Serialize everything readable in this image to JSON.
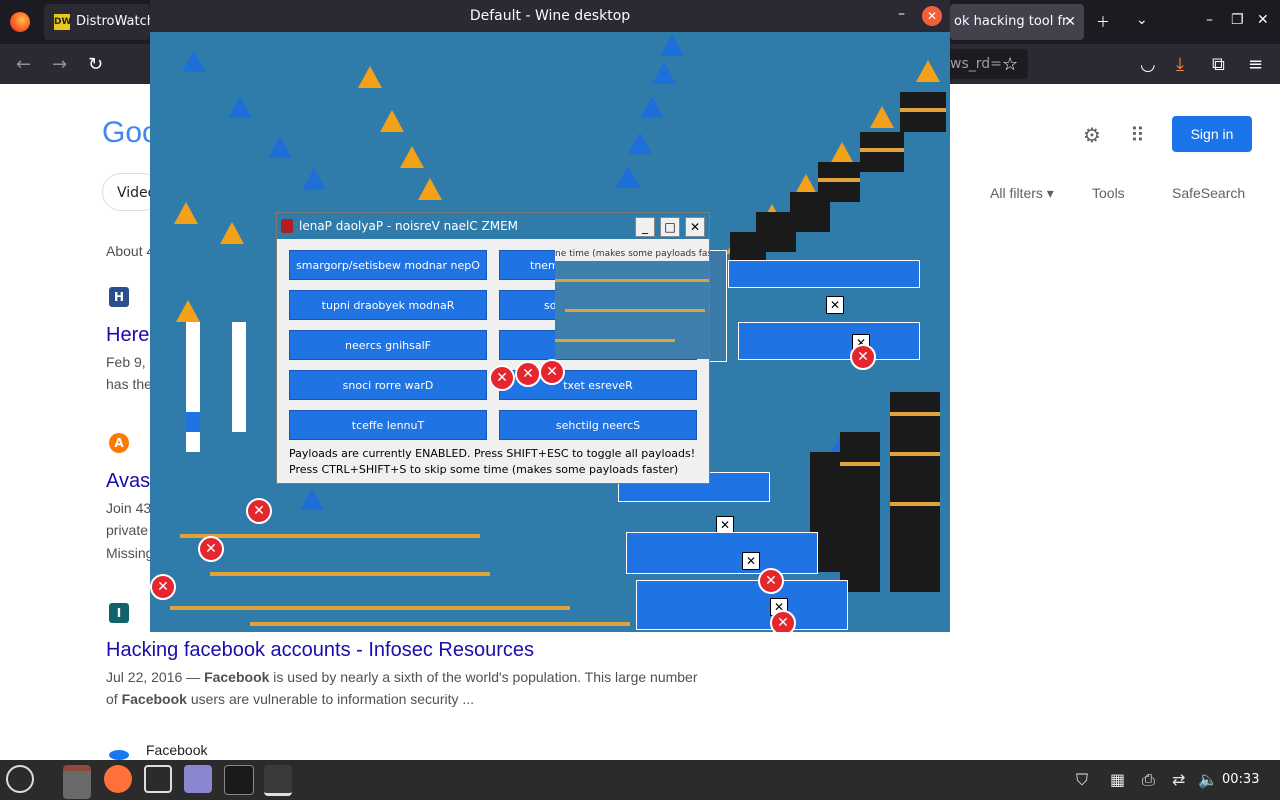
{
  "browser": {
    "tab1_label": "DistroWatch",
    "tab1_icon": "DW",
    "tab2_label": "ok hacking tool fr",
    "url_fragment": "ws_rd="
  },
  "google": {
    "logo": "Goo",
    "sign_in": "Sign in",
    "videos_chip": "Video",
    "all_filters": "All filters",
    "tools": "Tools",
    "safesearch": "SafeSearch",
    "about": "About 4",
    "results": [
      {
        "icon": "H",
        "title": "Here",
        "snippet1": "Feb 9,",
        "snippet2": "has the"
      },
      {
        "icon": "A",
        "title": "Avas",
        "snippet1": "Join 43",
        "snippet2": "private",
        "snippet3": "Missing"
      },
      {
        "icon": "I",
        "title": "Hacking facebook accounts - Infosec Resources",
        "date": "Jul 22, 2016 —",
        "bold1": "Facebook",
        "rest1": " is used by nearly a sixth of the world's population. This large number",
        "pre2": "of ",
        "bold2": "Facebook",
        "rest2": " users are vulnerable to information security ..."
      },
      {
        "site": "Facebook"
      }
    ]
  },
  "wine": {
    "title": "Default - Wine desktop"
  },
  "memz": {
    "title": "lenaP daolyaP - noisreV naelC ZMEM",
    "buttons_left": [
      "smargorp/setisbew modnar nepO",
      "tupni draobyek modnaR",
      "neercs gnihsalF",
      "snoci rorre warD",
      "tceffe lennuT"
    ],
    "buttons_right": [
      "tnem",
      "sdr",
      "",
      "txet esreveR",
      "sehctilg neercS"
    ],
    "info1": "Payloads are currently ENABLED. Press SHIFT+ESC to toggle all payloads!",
    "info2": "Press CTRL+SHIFT+S to skip some time (makes some payloads faster)",
    "ghost_text": "ne time (makes some payloads faster)"
  },
  "taskbar": {
    "clock": "00:33"
  }
}
